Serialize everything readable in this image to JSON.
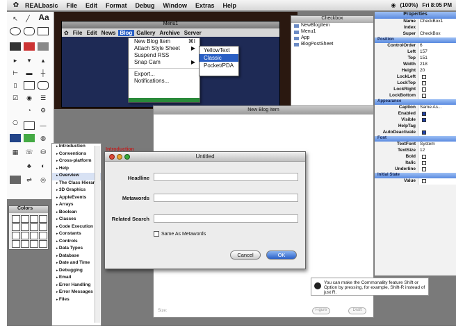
{
  "menubar": {
    "app": "REALbasic",
    "items": [
      "File",
      "Edit",
      "Format",
      "Debug",
      "Window",
      "Extras",
      "Help"
    ],
    "clock": "Fri 8:05 PM",
    "volume": "(100%)"
  },
  "menu_window": {
    "title": "Menu1",
    "items": [
      "File",
      "Edit",
      "News",
      "Blog",
      "Gallery",
      "Archive",
      "Server"
    ],
    "active": "Blog"
  },
  "blog_menu": {
    "items": [
      {
        "label": "New Blog Item",
        "key": "⌘I"
      },
      {
        "label": "Attach Style Sheet",
        "key": "▶"
      },
      {
        "label": "Suspend RSS",
        "key": ""
      },
      {
        "label": "Snap Cam",
        "key": "▶"
      }
    ],
    "items2": [
      "Export...",
      "Notifications..."
    ]
  },
  "style_submenu": [
    "YellowText",
    "Classic",
    "Pocket/PDA"
  ],
  "project_window": {
    "title": "Checkbox",
    "rows": [
      "NewBlogItem",
      "Menu1",
      "App",
      "BlogPostSheet"
    ]
  },
  "properties": {
    "title": "Properties",
    "top": [
      {
        "name": "Name",
        "value": "CheckBox1"
      },
      {
        "name": "Index",
        "value": ""
      },
      {
        "name": "Super",
        "value": "CheckBox"
      }
    ],
    "sections": [
      {
        "title": "Position",
        "rows": [
          {
            "name": "ControlOrder",
            "value": "6"
          },
          {
            "name": "Left",
            "value": "157"
          },
          {
            "name": "Top",
            "value": "151"
          },
          {
            "name": "Width",
            "value": "218"
          },
          {
            "name": "Height",
            "value": "20"
          },
          {
            "name": "LockLeft",
            "check": false
          },
          {
            "name": "LockTop",
            "check": false
          },
          {
            "name": "LockRight",
            "check": false
          },
          {
            "name": "LockBottom",
            "check": false
          }
        ]
      },
      {
        "title": "Appearance",
        "rows": [
          {
            "name": "Caption",
            "value": "Same As..."
          },
          {
            "name": "Enabled",
            "check": true
          },
          {
            "name": "Visible",
            "check": true
          },
          {
            "name": "HelpTag",
            "value": ""
          },
          {
            "name": "AutoDeactivate",
            "check": true
          }
        ]
      },
      {
        "title": "Font",
        "rows": [
          {
            "name": "TextFont",
            "value": "System"
          },
          {
            "name": "TextSize",
            "value": "12"
          },
          {
            "name": "Bold",
            "check": false
          },
          {
            "name": "Italic",
            "check": false
          },
          {
            "name": "Underline",
            "check": false
          }
        ]
      },
      {
        "title": "Initial State",
        "rows": [
          {
            "name": "Value",
            "check": false
          }
        ]
      }
    ]
  },
  "blog_window": {
    "title": "New Blog Item",
    "footer": "Size:",
    "buttons": [
      "Figure",
      "Draft"
    ]
  },
  "topics": {
    "items": [
      "Introduction",
      "Conventions",
      "Cross-platform",
      "Help",
      "Overview",
      "The Class Hierar...",
      "3D Graphics",
      "AppleEvents",
      "Arrays",
      "Boolean",
      "Classes",
      "Code Execution",
      "Constants",
      "Controls",
      "Data Types",
      "Database",
      "Date and Time",
      "Debugging",
      "Email",
      "Error Handling",
      "Error Messages",
      "Files"
    ],
    "selected": "Overview"
  },
  "intro_label": "Introduction",
  "colors_palette": {
    "title": "Colors"
  },
  "dialog": {
    "title": "Untitled",
    "headline_label": "Headline",
    "metawords_label": "Metawords",
    "related_label": "Related Search",
    "checkbox_label": "Same As Metawords",
    "cancel": "Cancel",
    "ok": "OK"
  },
  "tip": "You can make the Commonality feature Shift or Option by pressing, for example, Shift-R instead of just R."
}
